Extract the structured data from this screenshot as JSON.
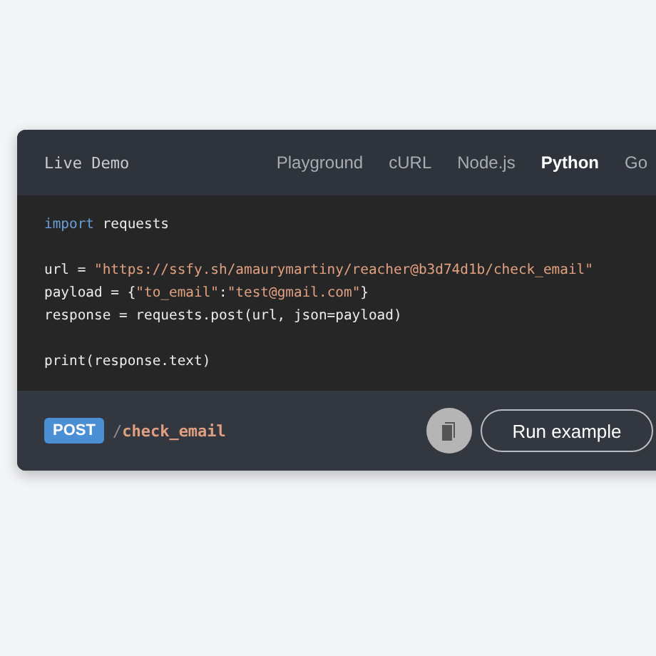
{
  "header": {
    "title": "Live Demo"
  },
  "tabs": [
    {
      "label": "Playground",
      "selected": false
    },
    {
      "label": "cURL",
      "selected": false
    },
    {
      "label": "Node.js",
      "selected": false
    },
    {
      "label": "Python",
      "selected": true
    },
    {
      "label": "Go",
      "selected": false
    }
  ],
  "code": [
    {
      "tokens": [
        {
          "kind": "keyword",
          "text": "import"
        },
        {
          "kind": "plain",
          "text": " requests"
        }
      ]
    },
    {
      "kind": "blank"
    },
    {
      "tokens": [
        {
          "kind": "plain",
          "text": "url = "
        },
        {
          "kind": "string",
          "text": "\"https://ssfy.sh/amaurymartiny/reacher@b3d74d1b/check_email\""
        }
      ]
    },
    {
      "tokens": [
        {
          "kind": "plain",
          "text": "payload = {"
        },
        {
          "kind": "string",
          "text": "\"to_email\""
        },
        {
          "kind": "plain",
          "text": ":"
        },
        {
          "kind": "string",
          "text": "\"test@gmail.com\""
        },
        {
          "kind": "plain",
          "text": "}"
        }
      ]
    },
    {
      "tokens": [
        {
          "kind": "plain",
          "text": "response = requests.post(url, json=payload)"
        }
      ]
    },
    {
      "kind": "blank"
    },
    {
      "tokens": [
        {
          "kind": "plain",
          "text": "print(response.text)"
        }
      ]
    }
  ],
  "footer": {
    "method": "POST",
    "slash": "/",
    "endpoint": "check_email",
    "run_button": "Run example"
  }
}
